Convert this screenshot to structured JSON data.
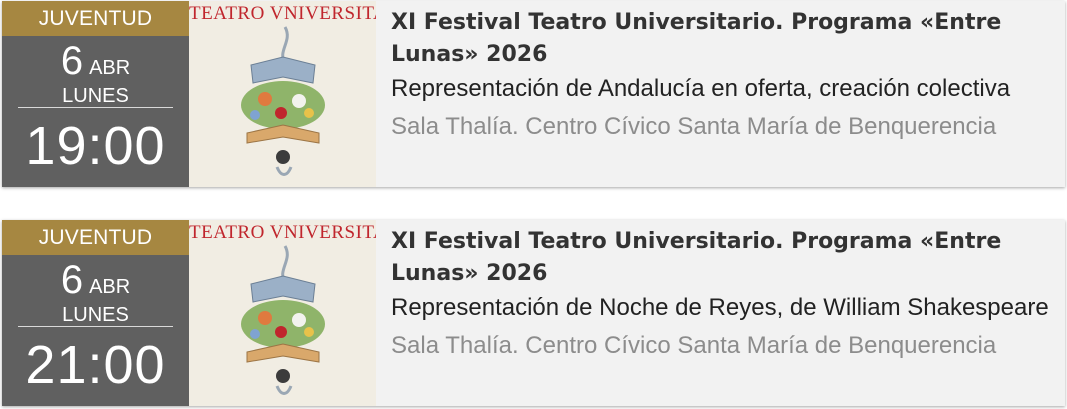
{
  "events": [
    {
      "category": "JUVENTUD",
      "day": "6",
      "month": "ABR",
      "weekday": "LUNES",
      "time": "19:00",
      "poster_title": "TEATRO VNIVERSITARIO",
      "title": "XI Festival Teatro Universitario. Programa «Entre Lunas» 2026",
      "description": "Representación de Andalucía en oferta, creación colectiva",
      "venue": "Sala Thalía. Centro Cívico Santa María de Benquerencia"
    },
    {
      "category": "JUVENTUD",
      "day": "6",
      "month": "ABR",
      "weekday": "LUNES",
      "time": "21:00",
      "poster_title": "TEATRO VNIVERSITARIO",
      "title": "XI Festival Teatro Universitario. Programa «Entre Lunas» 2026",
      "description": "Representación de Noche de Reyes, de William Shakespeare",
      "venue": "Sala Thalía. Centro Cívico Santa María de Benquerencia"
    }
  ],
  "colors": {
    "category_band": "#a68741",
    "date_panel": "#606060",
    "card_background": "#f2f2f2",
    "poster_title": "#c0262d"
  }
}
